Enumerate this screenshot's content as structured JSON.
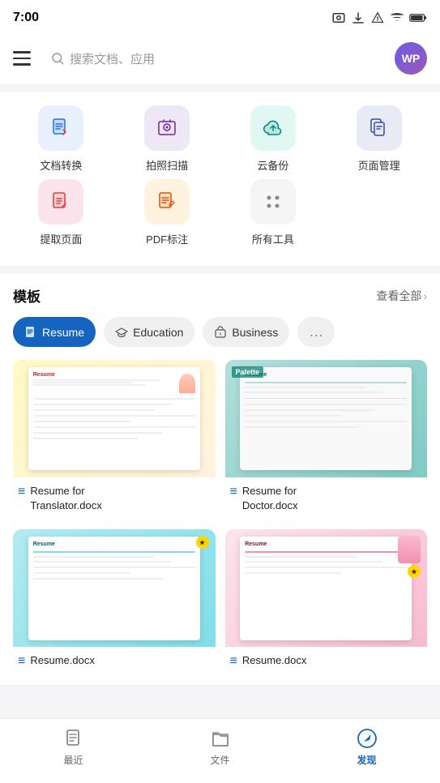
{
  "statusBar": {
    "time": "7:00",
    "icons": [
      "photo",
      "download",
      "warning",
      "wifi",
      "battery"
    ]
  },
  "searchBar": {
    "placeholder": "搜索文档、应用",
    "avatarText": "WP",
    "menuLabel": "menu"
  },
  "tools": {
    "row1": [
      {
        "id": "doc-convert",
        "label": "文档转换",
        "colorClass": "blue"
      },
      {
        "id": "photo-scan",
        "label": "拍照扫描",
        "colorClass": "purple"
      },
      {
        "id": "cloud-backup",
        "label": "云备份",
        "colorClass": "teal"
      },
      {
        "id": "page-manage",
        "label": "页面管理",
        "colorClass": "indigo"
      }
    ],
    "row2": [
      {
        "id": "extract-page",
        "label": "提取页面",
        "colorClass": "pink"
      },
      {
        "id": "pdf-note",
        "label": "PDF标注",
        "colorClass": "orange"
      },
      {
        "id": "all-tools",
        "label": "所有工具",
        "colorClass": "gray"
      }
    ]
  },
  "templates": {
    "sectionTitle": "模板",
    "viewAll": "查看全部",
    "categories": [
      {
        "id": "resume",
        "label": "Resume",
        "active": true
      },
      {
        "id": "education",
        "label": "Education",
        "active": false
      },
      {
        "id": "business",
        "label": "Business",
        "active": false
      },
      {
        "id": "more",
        "label": "更多",
        "active": false
      }
    ],
    "cards": [
      {
        "id": "resume-translator",
        "name": "Resume for\nTranslator.docx",
        "thumbType": "warm"
      },
      {
        "id": "resume-doctor",
        "name": "Resume for\nDoctor.docx",
        "thumbType": "teal"
      },
      {
        "id": "resume-3",
        "name": "Resume.docx",
        "thumbType": "cyan"
      },
      {
        "id": "resume-4",
        "name": "Resume.docx",
        "thumbType": "pink"
      }
    ]
  },
  "bottomNav": {
    "items": [
      {
        "id": "recent",
        "label": "最近",
        "active": false
      },
      {
        "id": "files",
        "label": "文件",
        "active": false
      },
      {
        "id": "discover",
        "label": "发现",
        "active": true
      }
    ]
  }
}
